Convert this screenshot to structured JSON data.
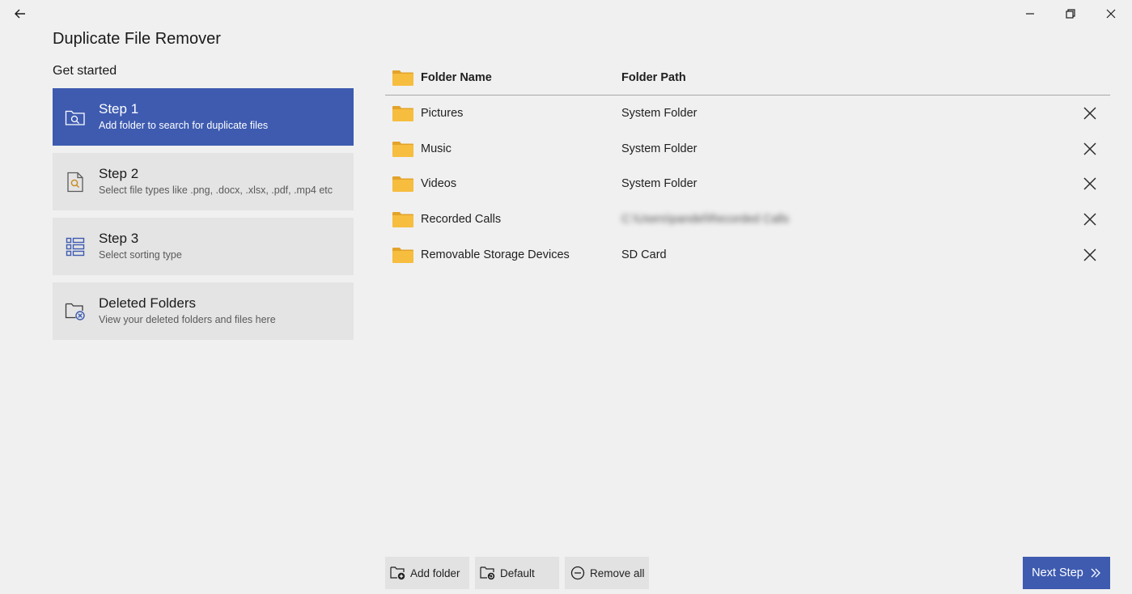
{
  "window": {
    "title": "Duplicate File Remover",
    "back_icon": "back-arrow-icon",
    "controls": [
      "minimize-icon",
      "restore-icon",
      "close-icon"
    ]
  },
  "sidebar": {
    "heading": "Get started",
    "steps": [
      {
        "title": "Step 1",
        "subtitle": "Add folder to search for duplicate files",
        "icon": "folder-search-icon",
        "active": true
      },
      {
        "title": "Step 2",
        "subtitle": "Select file types like .png, .docx, .xlsx, .pdf, .mp4 etc",
        "icon": "file-search-icon",
        "active": false
      },
      {
        "title": "Step 3",
        "subtitle": "Select sorting type",
        "icon": "list-sort-icon",
        "active": false
      },
      {
        "title": "Deleted Folders",
        "subtitle": "View your deleted folders and files here",
        "icon": "folder-deleted-icon",
        "active": false
      }
    ]
  },
  "table": {
    "columns": [
      "Folder Name",
      "Folder Path"
    ],
    "rows": [
      {
        "name": "Pictures",
        "path": "System Folder"
      },
      {
        "name": "Music",
        "path": "System Folder"
      },
      {
        "name": "Videos",
        "path": "System Folder"
      },
      {
        "name": "Recorded Calls",
        "path": "C:\\Users\\pandel\\Recorded Calls",
        "blurred": true
      },
      {
        "name": "Removable Storage Devices",
        "path": "SD Card"
      }
    ]
  },
  "actions": {
    "add_folder": "Add folder",
    "default": "Default",
    "remove_all": "Remove all",
    "next_step": "Next Step"
  },
  "colors": {
    "accent": "#3e5bb0",
    "background": "#f0f0f0",
    "card": "#e4e4e4",
    "folder": "#f4b73a"
  }
}
